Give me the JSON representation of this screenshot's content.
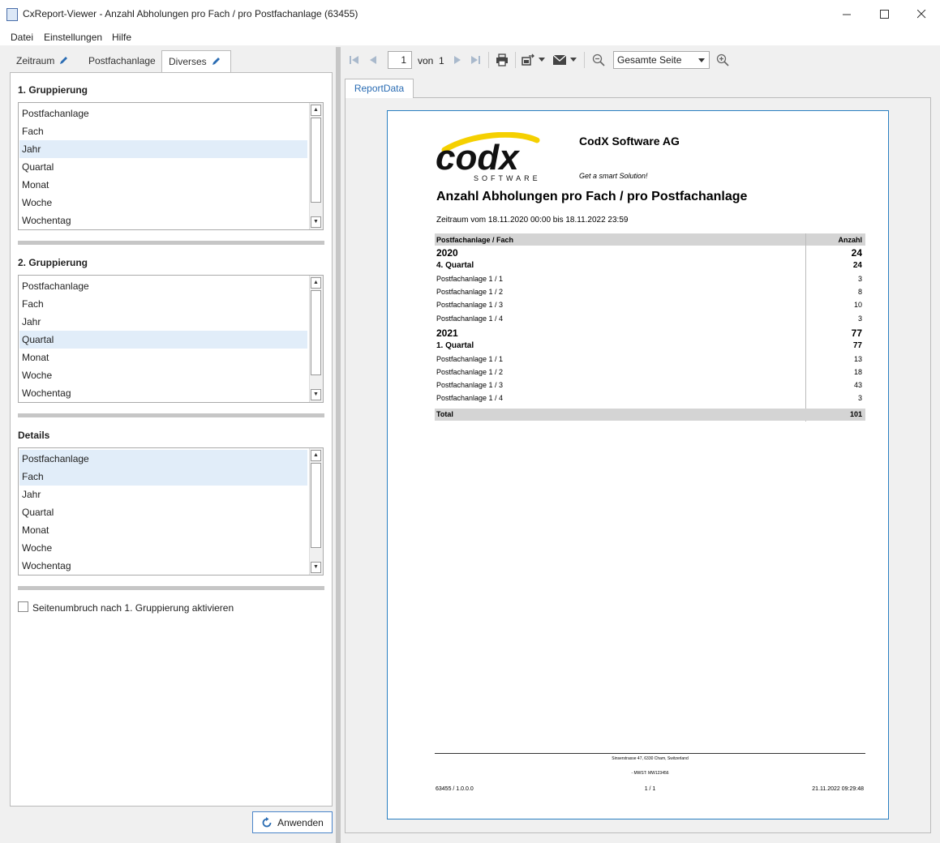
{
  "window": {
    "title": "CxReport-Viewer - Anzahl Abholungen pro Fach / pro Postfachanlage (63455)"
  },
  "menu": [
    "Datei",
    "Einstellungen",
    "Hilfe"
  ],
  "tabs": [
    {
      "label": "Zeitraum",
      "editable": true,
      "active": false
    },
    {
      "label": "Postfachanlage",
      "editable": false,
      "active": false
    },
    {
      "label": "Diverses",
      "editable": true,
      "active": true
    }
  ],
  "groups": [
    {
      "title": "1. Gruppierung",
      "items": [
        "Postfachanlage",
        "Fach",
        "Jahr",
        "Quartal",
        "Monat",
        "Woche",
        "Wochentag"
      ],
      "selected": [
        2
      ]
    },
    {
      "title": "2. Gruppierung",
      "items": [
        "Postfachanlage",
        "Fach",
        "Jahr",
        "Quartal",
        "Monat",
        "Woche",
        "Wochentag"
      ],
      "selected": [
        3
      ]
    },
    {
      "title": "Details",
      "items": [
        "Postfachanlage",
        "Fach",
        "Jahr",
        "Quartal",
        "Monat",
        "Woche",
        "Wochentag"
      ],
      "selected": [
        0,
        1
      ]
    }
  ],
  "checkbox_label": "Seitenumbruch nach 1. Gruppierung aktivieren",
  "apply_label": "Anwenden",
  "toolbar": {
    "page": "1",
    "of_label": "von",
    "total_pages": "1",
    "zoom": "Gesamte Seite"
  },
  "report_tab": "ReportData",
  "report": {
    "company": "CodX Software AG",
    "logo_word": "codx",
    "logo_sub": "SOFTWARE",
    "slogan": "Get a smart Solution!",
    "title": "Anzahl Abholungen pro Fach / pro Postfachanlage",
    "period": "Zeitraum vom 18.11.2020 00:00 bis 18.11.2022 23:59",
    "col1": "Postfachanlage / Fach",
    "col2": "Anzahl",
    "rows": [
      {
        "label": "2020",
        "value": "24",
        "level": "year"
      },
      {
        "label": "4. Quartal",
        "value": "24",
        "level": "quarter"
      },
      {
        "label": "Postfachanlage 1 / 1",
        "value": "3",
        "level": "detail"
      },
      {
        "label": "Postfachanlage 1 / 2",
        "value": "8",
        "level": "detail"
      },
      {
        "label": "Postfachanlage 1 / 3",
        "value": "10",
        "level": "detail"
      },
      {
        "label": "Postfachanlage 1 / 4",
        "value": "3",
        "level": "detail"
      },
      {
        "label": "2021",
        "value": "77",
        "level": "year"
      },
      {
        "label": "1. Quartal",
        "value": "77",
        "level": "quarter"
      },
      {
        "label": "Postfachanlage 1 / 1",
        "value": "13",
        "level": "detail"
      },
      {
        "label": "Postfachanlage 1 / 2",
        "value": "18",
        "level": "detail"
      },
      {
        "label": "Postfachanlage 1 / 3",
        "value": "43",
        "level": "detail"
      },
      {
        "label": "Postfachanlage 1 / 4",
        "value": "3",
        "level": "detail"
      }
    ],
    "total_label": "Total",
    "total_value": "101",
    "footer_address": "Sinserstrasse 47, 6330 Cham, Switzerland",
    "footer_vat": "- MWST: MW123456",
    "footer_left": "63455 / 1.0.0.0",
    "footer_center": "1 / 1",
    "footer_right": "21.11.2022 09:29:48"
  }
}
